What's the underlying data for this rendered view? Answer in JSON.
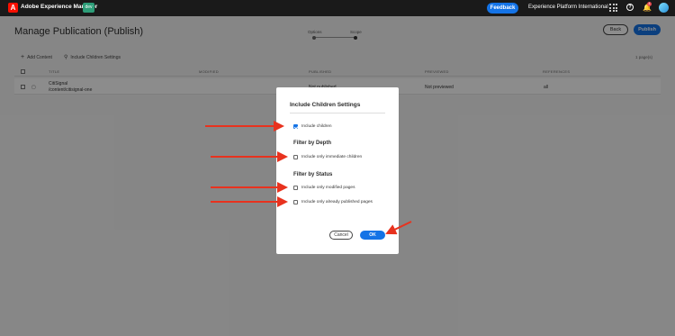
{
  "topbar": {
    "logo_letter": "A",
    "app_title": "Adobe Experience Manager",
    "env_badge": "dev",
    "feedback_label": "Feedback",
    "org_name": "Experience Platform International",
    "help_glyph": "?",
    "bell_glyph": "🔔",
    "notification_count": "4",
    "icons": [
      "adobe-logo-icon",
      "apps-grid-icon",
      "help-icon",
      "bell-icon",
      "avatar"
    ]
  },
  "page": {
    "title": "Manage Publication (Publish)",
    "steps": [
      "Options",
      "Scope"
    ],
    "current_step": "Scope",
    "back_label": "Back",
    "publish_label": "Publish",
    "add_content_label": "Add Content",
    "include_children_settings_label": "Include Children Settings",
    "pages_count": "1 page(s)"
  },
  "table": {
    "columns": [
      "TITLE",
      "MODIFIED",
      "PUBLISHED",
      "PREVIEWED",
      "REFERENCES"
    ],
    "rows": [
      {
        "title": "CitiSignal",
        "path": "/content/citisignal-one",
        "modified": "",
        "published": "Not published",
        "previewed": "Not previewed",
        "references": "all"
      }
    ]
  },
  "dialog": {
    "title": "Include Children Settings",
    "include_children": {
      "label": "Include children",
      "checked": true
    },
    "depth_heading": "Filter by Depth",
    "immediate_children": {
      "label": "Include only immediate children",
      "checked": false
    },
    "status_heading": "Filter by Status",
    "modified_pages": {
      "label": "Include only modified pages",
      "checked": false
    },
    "published_pages": {
      "label": "Include only already published pages",
      "checked": false
    },
    "cancel_label": "Cancel",
    "ok_label": "OK"
  },
  "colors": {
    "accent": "#1473e6",
    "topbar": "#1a1a1a",
    "annotation_arrow": "#e8321e",
    "env_badge": "#2d9d78"
  }
}
